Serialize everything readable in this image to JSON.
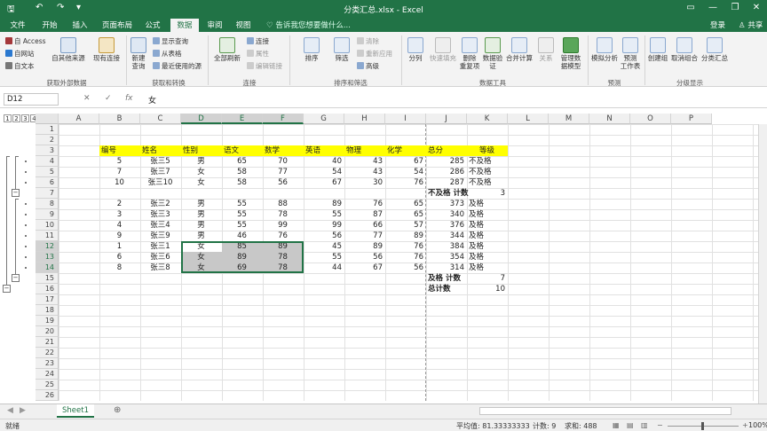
{
  "window": {
    "title": "分类汇总.xlsx - Excel",
    "controls": [
      "▭",
      "—",
      "❐",
      "✕"
    ]
  },
  "quick_access": {
    "save": "🖫",
    "undo": "↶",
    "redo": "↷",
    "more": "▾"
  },
  "menu": {
    "tabs": [
      "文件",
      "开始",
      "插入",
      "页面布局",
      "公式",
      "数据",
      "审阅",
      "视图"
    ],
    "active": "数据",
    "tellme": "♡ 告诉我您想要做什么...",
    "signin": "登录",
    "share": "♙ 共享"
  },
  "ribbon": {
    "external": {
      "items": [
        "自 Access",
        "自网站",
        "自文本",
        "自其他来源",
        "现有连接"
      ],
      "group": "获取外部数据"
    },
    "transform": {
      "new_query": "新建\n查询",
      "items": [
        "显示查询",
        "从表格",
        "最近使用的源"
      ],
      "group": "获取和转换"
    },
    "connections": {
      "refresh": "全部刷新",
      "items": [
        "连接",
        "属性",
        "编辑链接"
      ],
      "group": "连接"
    },
    "sort": {
      "sort": "排序",
      "filter": "筛选",
      "items": [
        "清除",
        "重新应用",
        "高级"
      ],
      "group": "排序和筛选"
    },
    "tools": {
      "items": [
        "分列",
        "快速填充",
        "删除\n重复项",
        "数据验\n证",
        "合并计算",
        "关系",
        "管理数\n据模型"
      ],
      "group": "数据工具"
    },
    "forecast": {
      "items": [
        "模拟分析",
        "预测\n工作表"
      ],
      "group": "预测"
    },
    "outline": {
      "items": [
        "创建组",
        "取消组合",
        "分类汇总"
      ],
      "group": "分级显示"
    }
  },
  "formula_bar": {
    "name_box": "D12",
    "fx": "fx",
    "cancel": "✕",
    "enter": "✓",
    "content": "女"
  },
  "outline_levels": [
    "1",
    "2",
    "3",
    "4"
  ],
  "columns": [
    "A",
    "B",
    "C",
    "D",
    "E",
    "F",
    "G",
    "H",
    "I",
    "J",
    "K",
    "L",
    "M",
    "N",
    "O",
    "P"
  ],
  "rows": [
    "1",
    "2",
    "3",
    "4",
    "5",
    "6",
    "7",
    "8",
    "9",
    "10",
    "11",
    "12",
    "13",
    "14",
    "15",
    "16",
    "17",
    "18",
    "19",
    "20",
    "21",
    "22",
    "23",
    "24",
    "25",
    "26"
  ],
  "table": {
    "headers": [
      "编号",
      "姓名",
      "性别",
      "语文",
      "数学",
      "英语",
      "物理",
      "化学",
      "总分",
      "等级"
    ],
    "group1": [
      [
        "5",
        "张三5",
        "男",
        "65",
        "70",
        "40",
        "43",
        "67",
        "285",
        "不及格"
      ],
      [
        "7",
        "张三7",
        "女",
        "58",
        "77",
        "54",
        "43",
        "54",
        "286",
        "不及格"
      ],
      [
        "10",
        "张三10",
        "女",
        "58",
        "56",
        "67",
        "30",
        "76",
        "287",
        "不及格"
      ]
    ],
    "subtotal1": {
      "label": "不及格 计数",
      "value": "3"
    },
    "group2": [
      [
        "2",
        "张三2",
        "男",
        "55",
        "88",
        "89",
        "76",
        "65",
        "373",
        "及格"
      ],
      [
        "3",
        "张三3",
        "男",
        "55",
        "78",
        "55",
        "87",
        "65",
        "340",
        "及格"
      ],
      [
        "4",
        "张三4",
        "男",
        "55",
        "99",
        "99",
        "66",
        "57",
        "376",
        "及格"
      ],
      [
        "9",
        "张三9",
        "男",
        "46",
        "76",
        "56",
        "77",
        "89",
        "344",
        "及格"
      ],
      [
        "1",
        "张三1",
        "女",
        "85",
        "89",
        "45",
        "89",
        "76",
        "384",
        "及格"
      ],
      [
        "6",
        "张三6",
        "女",
        "89",
        "78",
        "55",
        "56",
        "76",
        "354",
        "及格"
      ],
      [
        "8",
        "张三8",
        "女",
        "69",
        "78",
        "44",
        "67",
        "56",
        "314",
        "及格"
      ]
    ],
    "subtotal2": {
      "label": "及格 计数",
      "value": "7"
    },
    "total": {
      "label": "总计数",
      "value": "10"
    }
  },
  "sheets": {
    "tabs": [
      "Sheet1"
    ],
    "add": "⊕"
  },
  "status": {
    "left": "就绪",
    "average": "平均值: 81.33333333",
    "count": "计数: 9",
    "sum": "求和: 488",
    "zoom": "100%"
  },
  "colors": {
    "accent": "#217346",
    "header_fill": "#ffff00",
    "selection_fill": "#c8c8c8"
  }
}
